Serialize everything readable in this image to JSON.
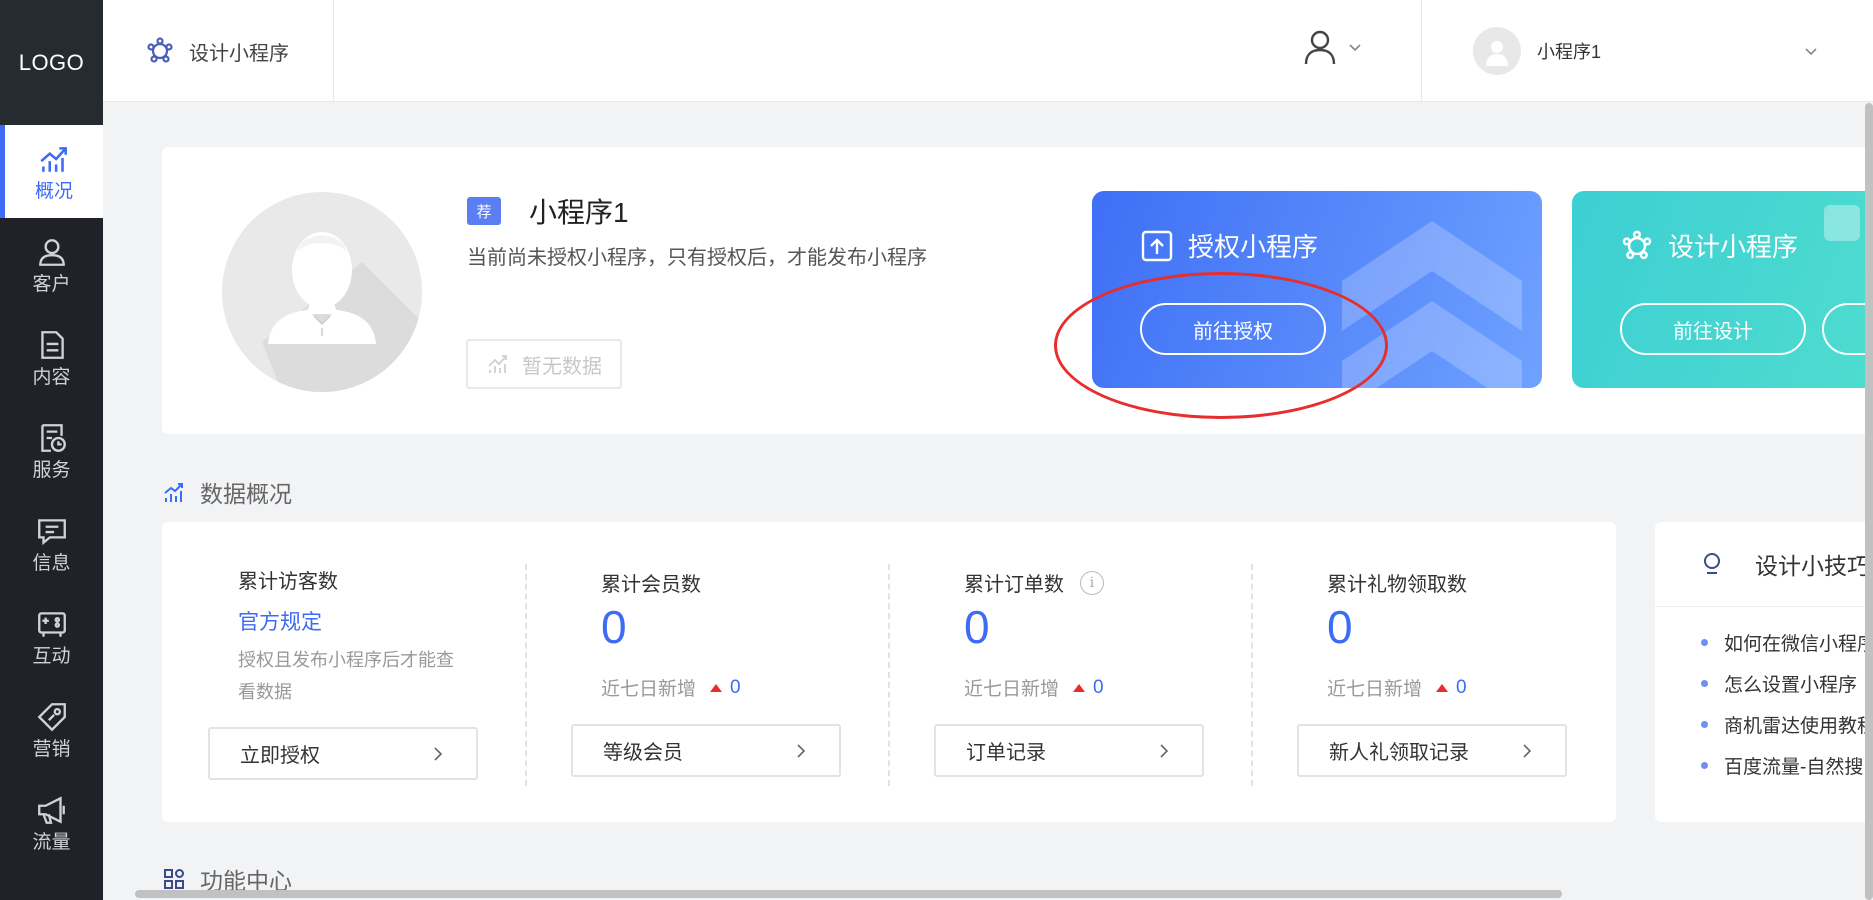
{
  "sidebar": {
    "logo": "LOGO",
    "items": [
      {
        "label": "概况",
        "icon": "chart-trend-icon",
        "active": true
      },
      {
        "label": "客户",
        "icon": "user-icon"
      },
      {
        "label": "内容",
        "icon": "document-icon"
      },
      {
        "label": "服务",
        "icon": "service-icon"
      },
      {
        "label": "信息",
        "icon": "message-icon"
      },
      {
        "label": "互动",
        "icon": "interact-icon"
      },
      {
        "label": "营销",
        "icon": "tag-icon"
      },
      {
        "label": "流量",
        "icon": "megaphone-icon"
      }
    ]
  },
  "header": {
    "design_label": "设计小程序",
    "account_name": "小程序1"
  },
  "top_card": {
    "badge": "荐",
    "app_name": "小程序1",
    "description": "当前尚未授权小程序，只有授权后，才能发布小程序",
    "no_data": "暂无数据",
    "promo_authorize": {
      "title": "授权小程序",
      "button": "前往授权"
    },
    "promo_design": {
      "title": "设计小程序",
      "button": "前往设计"
    }
  },
  "overview_title": "数据概况",
  "stats": [
    {
      "label": "累计访客数",
      "link": "官方规定",
      "note": "授权且发布小程序后才能查看数据",
      "button": "立即授权"
    },
    {
      "label": "累计会员数",
      "value": "0",
      "week_label": "近七日新增",
      "week_value": "0",
      "button": "等级会员"
    },
    {
      "label": "累计订单数",
      "info": "i",
      "value": "0",
      "week_label": "近七日新增",
      "week_value": "0",
      "button": "订单记录"
    },
    {
      "label": "累计礼物领取数",
      "value": "0",
      "week_label": "近七日新增",
      "week_value": "0",
      "button": "新人礼领取记录"
    }
  ],
  "tips": {
    "title": "设计小技巧",
    "items": [
      "如何在微信小程序",
      "怎么设置小程序",
      "商机雷达使用教程",
      "百度流量-自然搜"
    ]
  },
  "function_center_title": "功能中心",
  "colors": {
    "accent": "#3d6bf5",
    "sidebar_bg": "#1f2329",
    "teal": "#3ccfd3",
    "highlight_ring": "#e62e2e"
  }
}
